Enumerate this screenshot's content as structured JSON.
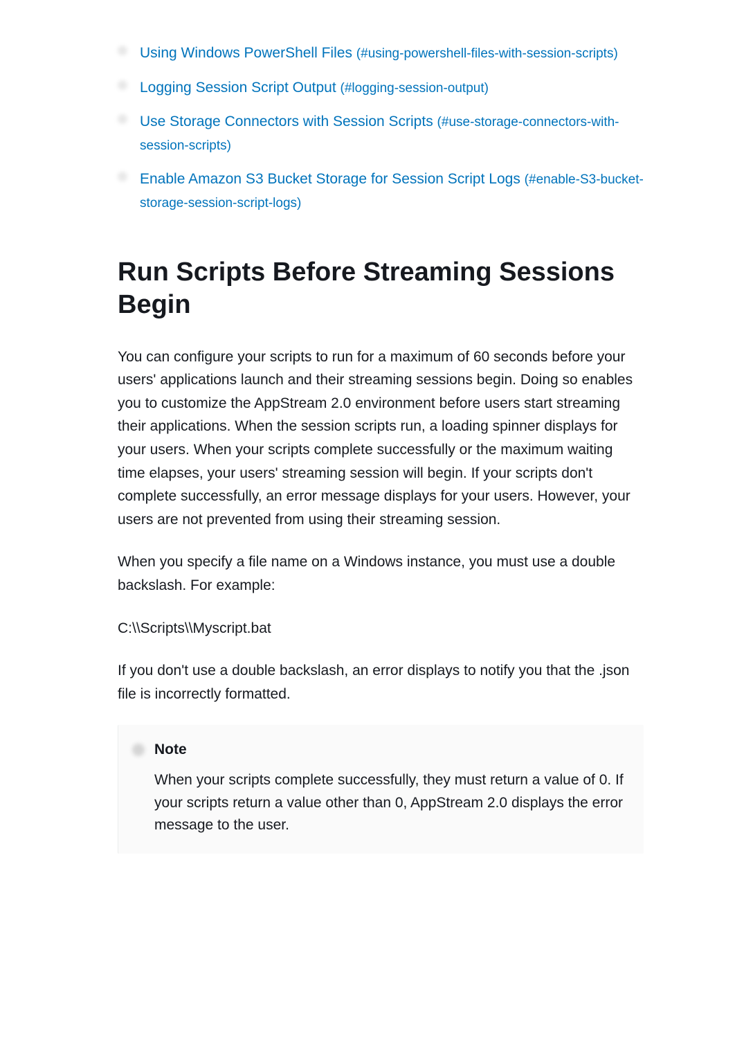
{
  "toc": {
    "items": [
      {
        "title": "Using Windows PowerShell Files",
        "anchor": "(#using-powershell-files-with-session-scripts)"
      },
      {
        "title": "Logging Session Script Output",
        "anchor": "(#logging-session-output)"
      },
      {
        "title": "Use Storage Connectors with Session Scripts",
        "anchor": "(#use-storage-connectors-with-session-scripts)"
      },
      {
        "title": "Enable Amazon S3 Bucket Storage for Session Script Logs",
        "anchor": "(#enable-S3-bucket-storage-session-script-logs)"
      }
    ]
  },
  "section": {
    "heading": "Run Scripts Before Streaming Sessions Begin",
    "paragraph1": "You can configure your scripts to run for a maximum of 60 seconds before your users' applications launch and their streaming sessions begin. Doing so enables you to customize the AppStream 2.0 environment before users start streaming their applications. When the session scripts run, a loading spinner displays for your users. When your scripts complete successfully or the maximum waiting time elapses, your users' streaming session will begin. If your scripts don't complete successfully, an error message displays for your users. However, your users are not prevented from using their streaming session.",
    "paragraph2": "When you specify a file name on a Windows instance, you must use a double backslash. For example:",
    "code_example": "C:\\\\Scripts\\\\Myscript.bat",
    "paragraph3": "If you don't use a double backslash, an error displays to notify you that the .json file is incorrectly formatted.",
    "note": {
      "title": "Note",
      "body": "When your scripts complete successfully, they must return a value of 0. If your scripts return a value other than 0, AppStream 2.0 displays the error message to the user."
    }
  }
}
